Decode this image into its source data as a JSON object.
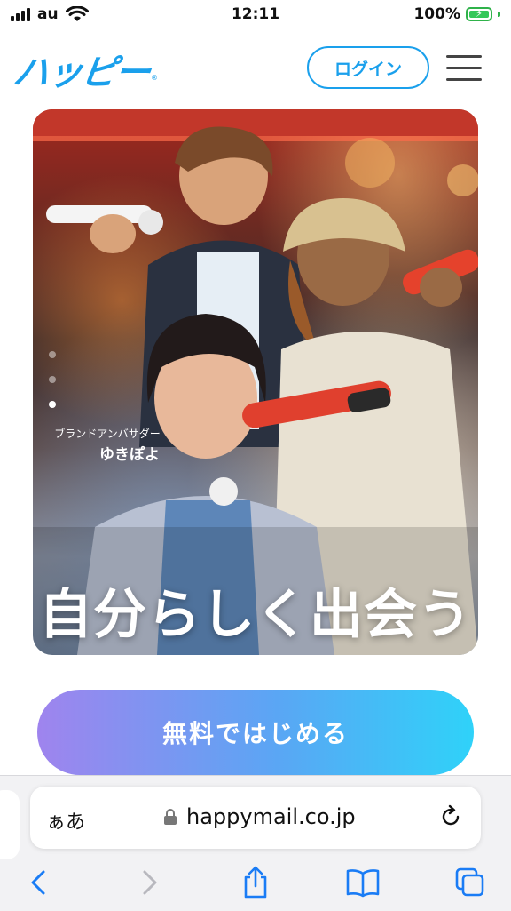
{
  "status_bar": {
    "carrier": "au",
    "time": "12:11",
    "battery": "100%"
  },
  "header": {
    "logo": "ハッピー",
    "logo_mark": "®",
    "login_label": "ログイン"
  },
  "hero": {
    "ambassador_label": "ブランドアンバサダー",
    "ambassador_name": "ゆきぽよ",
    "tagline": "自分らしく出会う",
    "slides": 3,
    "active_slide": 3
  },
  "cta": {
    "label": "無料ではじめる"
  },
  "safari": {
    "aa_label": "ぁあ",
    "url": "happymail.co.jp"
  },
  "colors": {
    "brand": "#1aa0ec",
    "cta_start": "#9f84ee",
    "cta_end": "#2fd2f9",
    "ios_blue": "#1a7cf5"
  }
}
